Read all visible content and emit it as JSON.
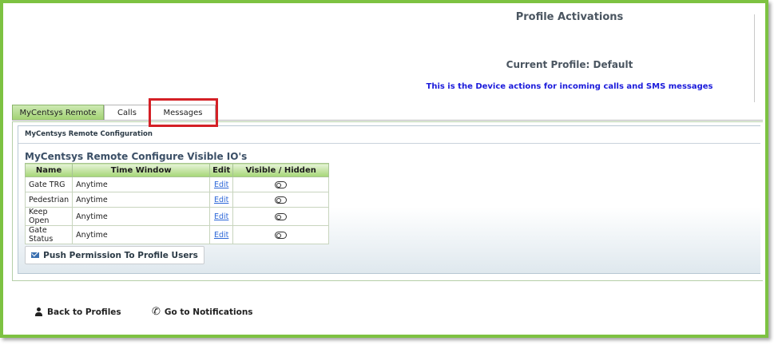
{
  "header": {
    "page_title": "Profile Activations",
    "current_profile": "Current Profile: Default",
    "description": "This is the Device actions for incoming calls and SMS messages"
  },
  "tabs": [
    {
      "label": "MyCentsys Remote",
      "active": true
    },
    {
      "label": "Calls",
      "active": false
    },
    {
      "label": "Messages",
      "active": false
    }
  ],
  "panel": {
    "header": "MyCentsys Remote Configuration",
    "section_title": "MyCentsys Remote Configure Visible IO's"
  },
  "table": {
    "columns": [
      "Name",
      "Time Window",
      "Edit",
      "Visible / Hidden"
    ],
    "rows": [
      {
        "name": "Gate TRG",
        "time_window": "Anytime",
        "edit": "Edit",
        "visible": false
      },
      {
        "name": "Pedestrian",
        "time_window": "Anytime",
        "edit": "Edit",
        "visible": false
      },
      {
        "name": "Keep Open",
        "time_window": "Anytime",
        "edit": "Edit",
        "visible": false
      },
      {
        "name": "Gate Status",
        "time_window": "Anytime",
        "edit": "Edit",
        "visible": false
      }
    ]
  },
  "actions": {
    "push_label": "Push Permission To Profile Users",
    "back_label": "Back to Profiles",
    "notifications_label": "Go to Notifications"
  },
  "icons": {
    "push": "envelope-icon",
    "back": "user-icon",
    "notifications": "phone-icon"
  },
  "colors": {
    "frame_border": "#7dc242",
    "highlight": "#d42026",
    "description_text": "#1a1adb",
    "link": "#2c67d8"
  }
}
